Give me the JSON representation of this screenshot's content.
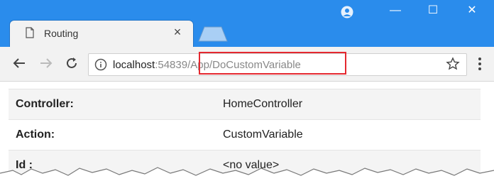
{
  "browser": {
    "tab": {
      "title": "Routing",
      "close_glyph": "×"
    },
    "window_controls": {
      "minimize": "—",
      "maximize": "☐",
      "close": "✕"
    },
    "address_bar": {
      "host": "localhost",
      "port": ":54839",
      "path": "/App/DoCustomVariable"
    },
    "accent_color": "#2a8cec",
    "highlight_color": "#e4282f"
  },
  "routes_table": {
    "rows": [
      {
        "key": "Controller:",
        "value": "HomeController"
      },
      {
        "key": "Action:",
        "value": "CustomVariable"
      },
      {
        "key": "Id :",
        "value": "<no value>"
      }
    ]
  }
}
